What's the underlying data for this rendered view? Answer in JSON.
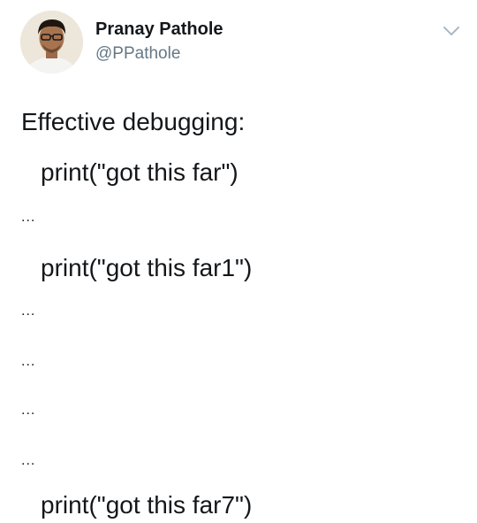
{
  "author": {
    "name": "Pranay Pathole",
    "handle": "@PPathole",
    "avatar_icon": "profile-photo",
    "menu_icon": "chevron-down-icon"
  },
  "tweet": {
    "lines": [
      "Effective debugging:",
      "print(\"got this far\")",
      "...",
      "print(\"got this far1\")",
      "...",
      "...",
      "...",
      "...",
      "print(\"got this far7\")"
    ]
  },
  "colors": {
    "text": "#14171a",
    "handle": "#657786",
    "chevron": "#aab8c2"
  }
}
